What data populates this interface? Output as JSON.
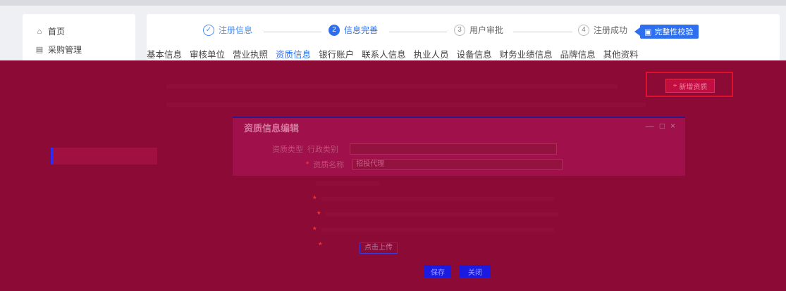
{
  "sidebar": {
    "items": [
      {
        "label": "首页",
        "icon": "home-icon"
      },
      {
        "label": "采购管理",
        "icon": "document-icon"
      }
    ]
  },
  "steps": [
    {
      "index": "✓",
      "label": "注册信息",
      "state": "done"
    },
    {
      "index": "2",
      "label": "信息完善",
      "state": "current"
    },
    {
      "index": "3",
      "label": "用户审批",
      "state": "wait"
    },
    {
      "index": "4",
      "label": "注册成功",
      "state": "wait"
    }
  ],
  "verify_button": {
    "label": "完整性校验",
    "icon": "check-document-icon"
  },
  "tabs": [
    "基本信息",
    "审核单位",
    "营业执照",
    "资质信息",
    "银行账户",
    "联系人信息",
    "执业人员",
    "设备信息",
    "财务业绩信息",
    "品牌信息",
    "其他资料"
  ],
  "active_tab": "资质信息",
  "dialog": {
    "title": "资质信息编辑",
    "controls": [
      "—",
      "□",
      "×"
    ],
    "fields": [
      {
        "label": "资质类型",
        "value": "行政类别"
      },
      {
        "label": "资质名称",
        "value": "招投代理"
      }
    ],
    "upload_label": "点击上传"
  },
  "add_button": {
    "label": "新增资质"
  },
  "footer_buttons": [
    "保存",
    "关闭"
  ],
  "colors": {
    "accent": "#2e6ff0",
    "overlay": "#8c0a36",
    "highlight": "#e0102a"
  }
}
